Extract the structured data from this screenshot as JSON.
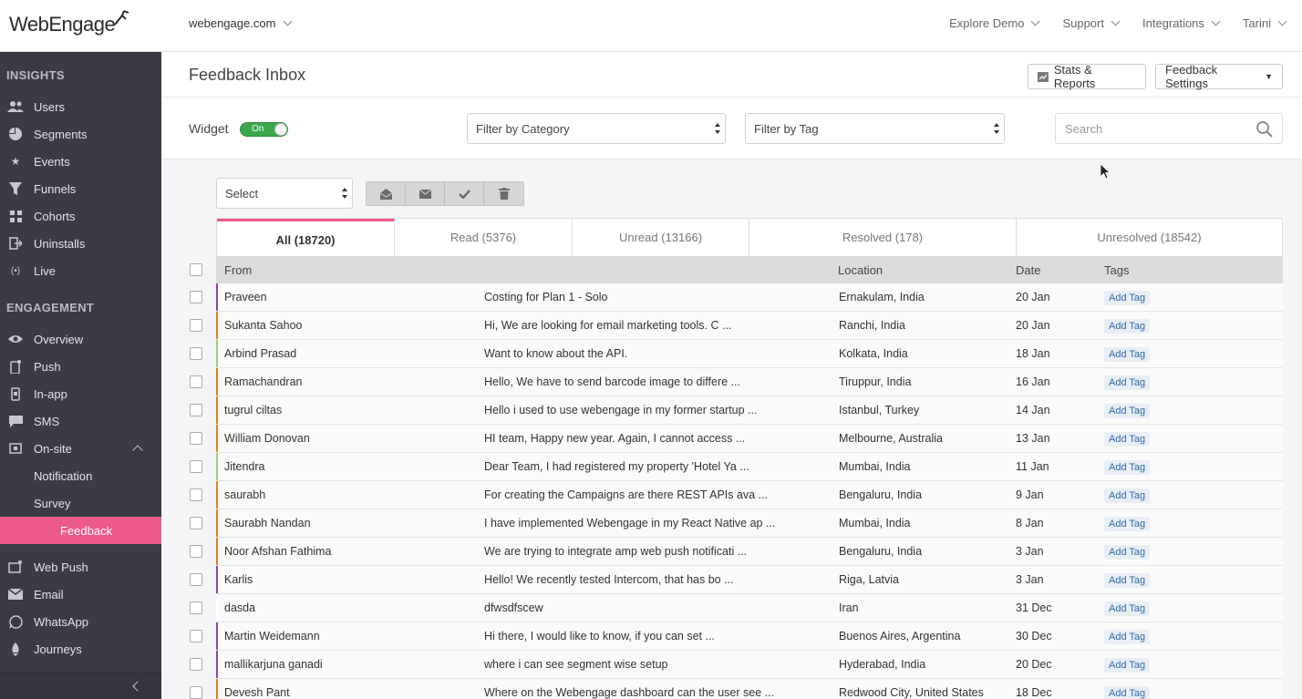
{
  "topbar": {
    "logo_text": "WebEngage",
    "account": "webengage.com",
    "nav": [
      {
        "label": "Explore Demo"
      },
      {
        "label": "Support"
      },
      {
        "label": "Integrations"
      },
      {
        "label": "Tarini"
      }
    ]
  },
  "sidebar": {
    "insights_title": "INSIGHTS",
    "insights": [
      {
        "label": "Users",
        "icon": "users-icon"
      },
      {
        "label": "Segments",
        "icon": "pie-chart-icon"
      },
      {
        "label": "Events",
        "icon": "star-icon"
      },
      {
        "label": "Funnels",
        "icon": "funnel-icon"
      },
      {
        "label": "Cohorts",
        "icon": "grid-icon"
      },
      {
        "label": "Uninstalls",
        "icon": "exit-icon"
      },
      {
        "label": "Live",
        "icon": "broadcast-icon"
      }
    ],
    "engagement_title": "ENGAGEMENT",
    "engagement": [
      {
        "label": "Overview",
        "icon": "eye-icon"
      },
      {
        "label": "Push",
        "icon": "mobile-push-icon"
      },
      {
        "label": "In-app",
        "icon": "mobile-icon"
      },
      {
        "label": "SMS",
        "icon": "sms-icon"
      },
      {
        "label": "On-site",
        "icon": "onsite-icon"
      }
    ],
    "onsite_sub": [
      {
        "label": "Notification"
      },
      {
        "label": "Survey"
      },
      {
        "label": "Feedback"
      }
    ],
    "channels": [
      {
        "label": "Web Push",
        "icon": "web-push-icon"
      },
      {
        "label": "Email",
        "icon": "envelope-icon"
      },
      {
        "label": "WhatsApp",
        "icon": "whatsapp-icon"
      },
      {
        "label": "Journeys",
        "icon": "rocket-icon"
      }
    ]
  },
  "header": {
    "title": "Feedback Inbox",
    "stats_label": "Stats & Reports",
    "settings_label": "Feedback Settings"
  },
  "filters": {
    "widget_label": "Widget",
    "widget_state": "On",
    "category": "Filter by Category",
    "tag": "Filter by Tag",
    "search_placeholder": "Search"
  },
  "bulk": {
    "select_label": "Select"
  },
  "tabs": [
    {
      "label": "All (18720)",
      "active": true
    },
    {
      "label": "Read (5376)"
    },
    {
      "label": "Unread (13166)"
    },
    {
      "label": "Resolved (178)"
    },
    {
      "label": "Unresolved (18542)"
    }
  ],
  "table": {
    "columns": {
      "from": "From",
      "location": "Location",
      "date": "Date",
      "tags": "Tags"
    },
    "add_tag_label": "Add Tag",
    "rows": [
      {
        "from": "Praveen",
        "message": "Costing for Plan 1 - Solo",
        "location": "Ernakulam, India",
        "date": "20 Jan",
        "color": "#8e44ad"
      },
      {
        "from": "Sukanta Sahoo",
        "message": "Hi, We are looking for email marketing tools. C ...",
        "location": "Ranchi, India",
        "date": "20 Jan",
        "color": "#e67e22"
      },
      {
        "from": "Arbind Prasad",
        "message": "Want to know about the API.",
        "location": "Kolkata, India",
        "date": "18 Jan",
        "color": "#9ad07a"
      },
      {
        "from": "Ramachandran",
        "message": "Hello, We have to send barcode image to differe ...",
        "location": "Tiruppur, India",
        "date": "16 Jan",
        "color": "#e67e22"
      },
      {
        "from": "tugrul ciltas",
        "message": "Hello i used to use webengage in my former startup ...",
        "location": "Istanbul, Turkey",
        "date": "14 Jan",
        "color": "#e67e22"
      },
      {
        "from": "William Donovan",
        "message": "HI team, Happy new year. Again, I cannot access ...",
        "location": "Melbourne, Australia",
        "date": "13 Jan",
        "color": "#e67e22"
      },
      {
        "from": "Jitendra",
        "message": "Dear Team, I had registered my property 'Hotel Ya ...",
        "location": "Mumbai, India",
        "date": "11 Jan",
        "color": "#9ad07a"
      },
      {
        "from": "saurabh",
        "message": "For creating the Campaigns are there REST APIs ava ...",
        "location": "Bengaluru, India",
        "date": "9 Jan",
        "color": "#e67e22"
      },
      {
        "from": "Saurabh Nandan",
        "message": "I have implemented Webengage in my React Native ap ...",
        "location": "Mumbai, India",
        "date": "8 Jan",
        "color": "#e67e22"
      },
      {
        "from": "Noor Afshan Fathima",
        "message": "We are trying to integrate amp web push notificati ...",
        "location": "Bengaluru, India",
        "date": "3 Jan",
        "color": "#e67e22"
      },
      {
        "from": "Karlis",
        "message": "Hello! We recently tested Intercom, that has bo ...",
        "location": "Riga, Latvia",
        "date": "3 Jan",
        "color": "#8e44ad"
      },
      {
        "from": "dasda",
        "message": "dfwsdfscew",
        "location": "Iran",
        "date": "31 Dec",
        "color": "#ffffff"
      },
      {
        "from": "Martin Weidemann",
        "message": "Hi there, I would like to know, if you can set ...",
        "location": "Buenos Aires, Argentina",
        "date": "30 Dec",
        "color": "#8e44ad"
      },
      {
        "from": "mallikarjuna ganadi",
        "message": "where i can see segment wise setup",
        "location": "Hyderabad, India",
        "date": "20 Dec",
        "color": "#8e44ad"
      },
      {
        "from": "Devesh Pant",
        "message": "Where on the Webengage dashboard can the user see ...",
        "location": "Redwood City, United States",
        "date": "18 Dec",
        "color": "#e67e22"
      }
    ]
  },
  "colors": {
    "accent": "#ee5a8a",
    "sidebar": "#3a3b45",
    "toggle_on": "#3aa84a"
  }
}
